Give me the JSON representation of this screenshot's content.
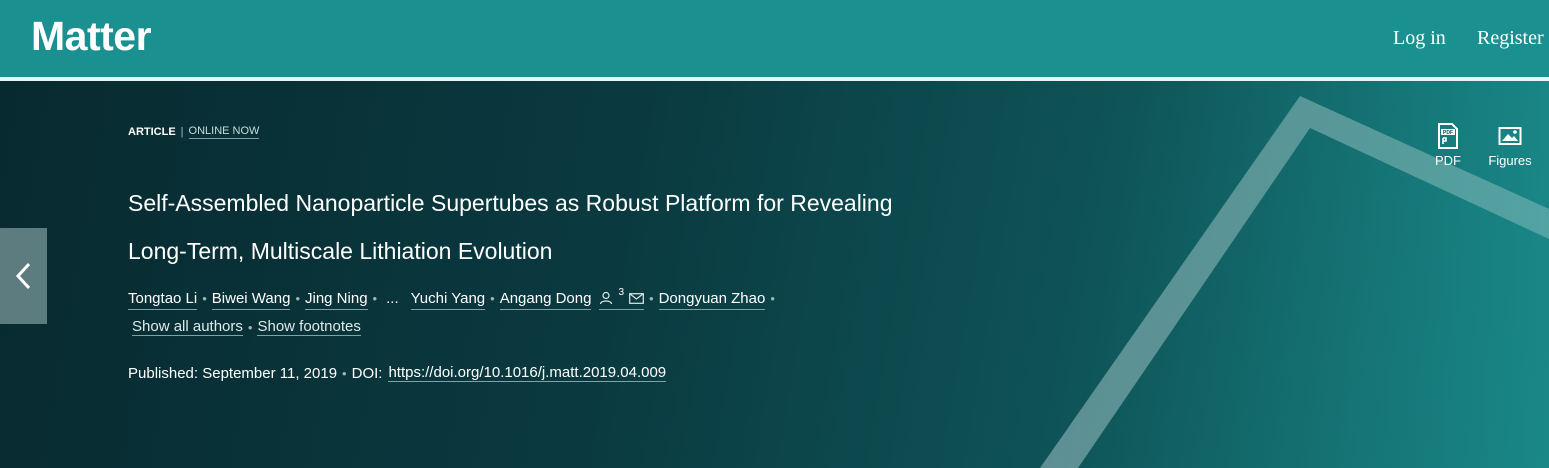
{
  "header": {
    "logo": "Matter",
    "login_label": "Log in",
    "register_label": "Register"
  },
  "article": {
    "type_label": "ARTICLE",
    "separator": "|",
    "status_label": "ONLINE NOW",
    "title_line1": "Self-Assembled Nanoparticle Supertubes as Robust Platform for Revealing",
    "title_line2": "Long-Term, Multiscale Lithiation Evolution",
    "authors": [
      "Tongtao Li",
      "Biwei Wang",
      "Jing Ning"
    ],
    "ellipsis": "...",
    "authors_after": [
      "Yuchi Yang",
      "Angang Dong"
    ],
    "corresponding_count": "3",
    "last_author": "Dongyuan Zhao",
    "show_all_authors": "Show all authors",
    "show_footnotes": "Show footnotes",
    "published_label": "Published: September 11, 2019",
    "doi_label": "DOI:",
    "doi_link": "https://doi.org/10.1016/j.matt.2019.04.009"
  },
  "tools": {
    "pdf_label": "PDF",
    "figures_label": "Figures"
  },
  "icons": {
    "back": "chevron-left-icon",
    "pdf": "pdf-icon",
    "figures": "image-icon",
    "person": "person-icon",
    "mail": "mail-icon"
  },
  "colors": {
    "header_bg": "#1a9090",
    "hero_dark": "#072a30",
    "hero_light": "#1a8585"
  }
}
